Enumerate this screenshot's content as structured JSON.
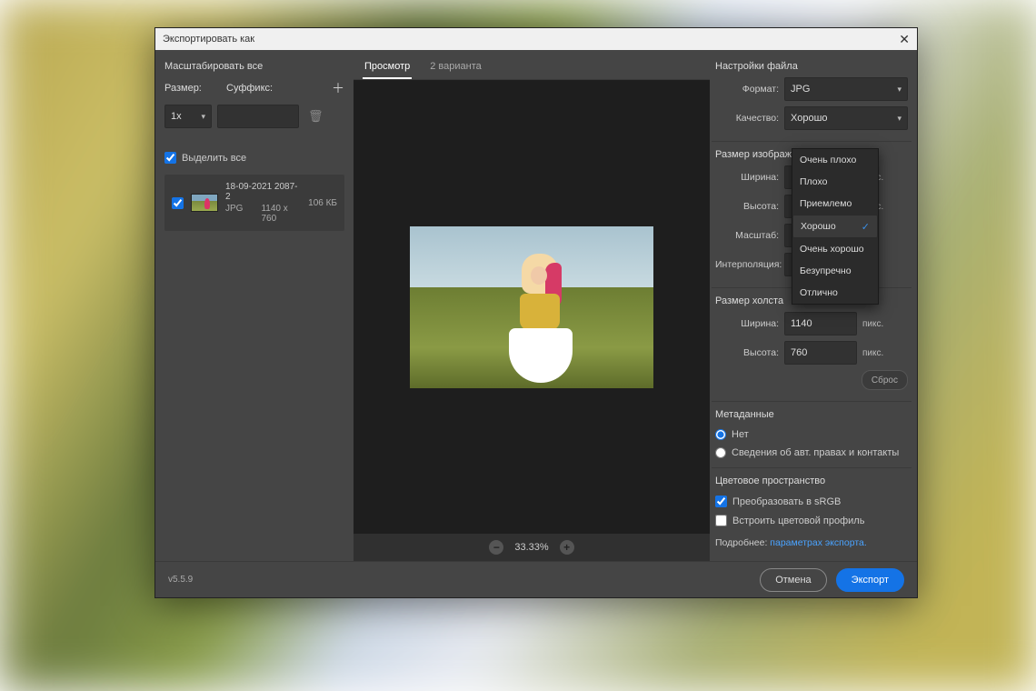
{
  "dialog": {
    "title": "Экспортировать как"
  },
  "left": {
    "scale_all": "Масштабировать все",
    "size_label": "Размер:",
    "suffix_label": "Суффикс:",
    "scale_value": "1x",
    "suffix_value": "",
    "select_all": "Выделить все",
    "asset": {
      "name": "18-09-2021 2087-2",
      "format": "JPG",
      "dims": "1140 x 760",
      "filesize": "106 КБ"
    }
  },
  "tabs": {
    "preview": "Просмотр",
    "variants": "2 варианта"
  },
  "zoom": {
    "level": "33.33%"
  },
  "settings": {
    "title": "Настройки файла",
    "format_label": "Формат:",
    "format_value": "JPG",
    "quality_label": "Качество:",
    "quality_value": "Хорошо",
    "quality_options": [
      "Очень плохо",
      "Плохо",
      "Приемлемо",
      "Хорошо",
      "Очень хорошо",
      "Безупречно",
      "Отлично"
    ],
    "quality_selected_index": 3
  },
  "image_size": {
    "title": "Размер изображе",
    "width_label": "Ширина:",
    "height_label": "Высота:",
    "scale_label": "Масштаб:",
    "interp_label": "Интерполяция:",
    "unit": "пикс."
  },
  "canvas_size": {
    "title": "Размер холста",
    "width_label": "Ширина:",
    "width_value": "1140",
    "height_label": "Высота:",
    "height_value": "760",
    "unit": "пикс.",
    "reset": "Сброс"
  },
  "metadata": {
    "title": "Метаданные",
    "none": "Нет",
    "rights": "Сведения об авт. правах и контакты"
  },
  "colorspace": {
    "title": "Цветовое пространство",
    "srgb": "Преобразовать в sRGB",
    "embed": "Встроить цветовой профиль"
  },
  "learn": {
    "prefix": "Подробнее: ",
    "link": "параметрах экспорта."
  },
  "footer": {
    "version": "v5.5.9",
    "cancel": "Отмена",
    "export": "Экспорт"
  }
}
